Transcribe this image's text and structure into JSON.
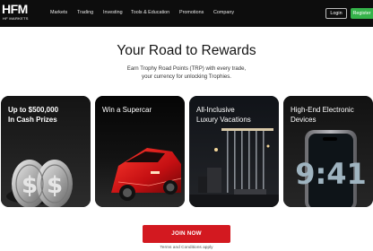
{
  "header": {
    "logo_text": "HFM",
    "logo_subtext": "HF MARKETS",
    "nav_items": [
      "Markets",
      "Trading",
      "Investing",
      "Tools & Education",
      "Promotions",
      "Company"
    ],
    "login_label": "Login",
    "register_label": "Register"
  },
  "hero": {
    "title": "Your Road to Rewards",
    "subtitle_line1": "Earn Trophy Road Points (TRP) with every trade,",
    "subtitle_line2": "your currency for unlocking Trophies."
  },
  "cards": [
    {
      "line1": "Up to $500,000",
      "line2": "In Cash Prizes",
      "image": "silver-dollar-coins"
    },
    {
      "line1": "Win a Supercar",
      "line2": "",
      "image": "red-supercar"
    },
    {
      "line1": "All-Inclusive",
      "line2": "Luxury Vacations",
      "image": "luxury-villa-night"
    },
    {
      "line1": "High-End Electronic",
      "line2": "Devices",
      "image": "smartphone"
    }
  ],
  "cta": {
    "join_label": "JOIN NOW",
    "terms_text": "Terms and Conditions apply"
  },
  "colors": {
    "nav_bg": "#0d0d0d",
    "register_green": "#35b34a",
    "join_red": "#d31920"
  }
}
